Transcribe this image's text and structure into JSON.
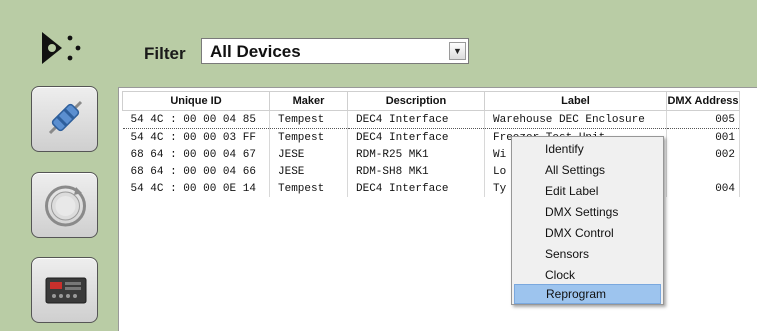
{
  "toolbar": {
    "filter_label": "Filter",
    "filter_value": "All Devices"
  },
  "sidebar": {
    "buttons": [
      {
        "icon": "fuse-icon"
      },
      {
        "icon": "refresh-icon"
      },
      {
        "icon": "device-icon"
      }
    ]
  },
  "table": {
    "columns": [
      "Unique ID",
      "Maker",
      "Description",
      "Label",
      "DMX Address"
    ],
    "rows": [
      [
        "54 4C : 00 00 04 85",
        "Tempest",
        "DEC4 Interface",
        "Warehouse DEC Enclosure",
        "005"
      ],
      [
        "54 4C : 00 00 03 FF",
        "Tempest",
        "DEC4 Interface",
        "Freezer Test Unit",
        "001"
      ],
      [
        "68 64 : 00 00 04 67",
        "JESE",
        "RDM-R25 MK1",
        "Wi",
        "002"
      ],
      [
        "68 64 : 00 00 04 66",
        "JESE",
        "RDM-SH8 MK1",
        "Lo",
        ""
      ],
      [
        "54 4C : 00 00 0E 14",
        "Tempest",
        "DEC4 Interface",
        "Ty",
        "004"
      ]
    ]
  },
  "context_menu": {
    "items": [
      "Identify",
      "All Settings",
      "Edit Label",
      "DMX Settings",
      "DMX Control",
      "Sensors",
      "Clock",
      "Reprogram"
    ],
    "highlighted": "Reprogram"
  },
  "colors": {
    "background": "#b9cca5",
    "menu_highlight": "#9dc4ee"
  }
}
